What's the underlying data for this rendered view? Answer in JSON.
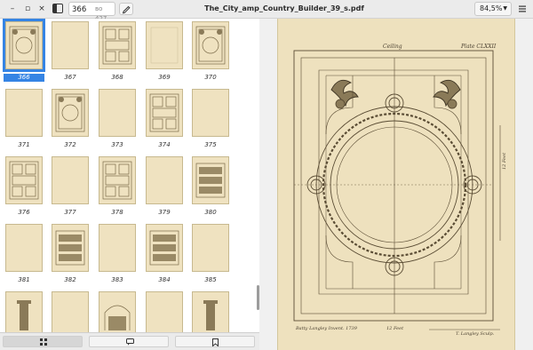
{
  "header": {
    "minimize_glyph": "–",
    "maximize_glyph": "▫",
    "close_glyph": "×",
    "page_number": "366",
    "page_of": "во 427",
    "title": "The_City_amp_Country_Builder_39_s.pdf",
    "zoom": "84,5%",
    "icons": [
      "sidebar-toggle-icon",
      "pencil-icon",
      "hamburger-menu-icon",
      "chevron-down-icon"
    ]
  },
  "sidebar": {
    "selected_page": "366",
    "thumbnails": [
      {
        "num": "366",
        "design": "ceiling"
      },
      {
        "num": "367",
        "design": "blank"
      },
      {
        "num": "368",
        "design": "grid"
      },
      {
        "num": "369",
        "design": "faint"
      },
      {
        "num": "370",
        "design": "ceiling"
      },
      {
        "num": "371",
        "design": "blank"
      },
      {
        "num": "372",
        "design": "ceiling"
      },
      {
        "num": "373",
        "design": "blank"
      },
      {
        "num": "374",
        "design": "grid"
      },
      {
        "num": "375",
        "design": "blank"
      },
      {
        "num": "376",
        "design": "grid"
      },
      {
        "num": "377",
        "design": "blank"
      },
      {
        "num": "378",
        "design": "grid"
      },
      {
        "num": "379",
        "design": "blank"
      },
      {
        "num": "380",
        "design": "panel"
      },
      {
        "num": "381",
        "design": "blank"
      },
      {
        "num": "382",
        "design": "panel"
      },
      {
        "num": "383",
        "design": "blank"
      },
      {
        "num": "384",
        "design": "panel"
      },
      {
        "num": "385",
        "design": "blank"
      },
      {
        "num": "",
        "design": "column"
      },
      {
        "num": "",
        "design": "blank"
      },
      {
        "num": "",
        "design": "arch"
      },
      {
        "num": "",
        "design": "blank"
      },
      {
        "num": "",
        "design": "column"
      }
    ],
    "footer_tabs": [
      "thumbnails-icon",
      "outline-icon",
      "bookmarks-icon"
    ]
  },
  "document": {
    "plate_caption_left": "Ceiling",
    "plate_number": "Plate CLXXII",
    "scale_right": "12 Feet",
    "credit_left": "Batty Langley Invent. 1739",
    "scale_bottom": "12 Feet",
    "credit_right": "T. Langley Sculp.",
    "colors": {
      "paper": "#eee1be",
      "ink": "#5a4c34",
      "accent": "#3584e4"
    }
  }
}
